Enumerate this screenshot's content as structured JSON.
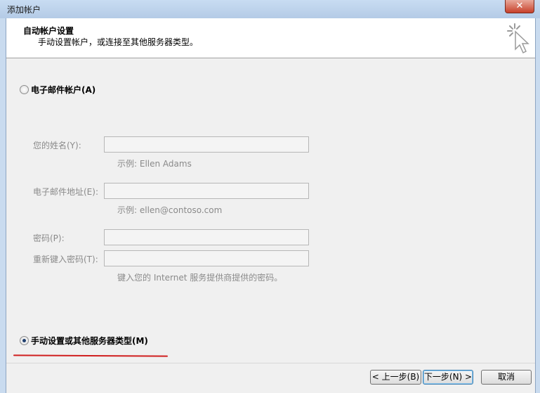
{
  "window": {
    "title": "添加帐户",
    "close_glyph": "✕"
  },
  "header": {
    "title": "自动帐户设置",
    "subtitle": "手动设置帐户，或连接至其他服务器类型。",
    "icon": "wizard-sparkle-cursor-icon"
  },
  "email_option": {
    "label": "电子邮件帐户(A)",
    "selected": false
  },
  "form": {
    "name_label": "您的姓名(Y):",
    "name_hint": "示例: Ellen Adams",
    "email_label": "电子邮件地址(E):",
    "email_hint": "示例: ellen@contoso.com",
    "password_label": "密码(P):",
    "retype_label": "重新键入密码(T):",
    "password_hint": "键入您的 Internet 服务提供商提供的密码。"
  },
  "manual_option": {
    "label": "手动设置或其他服务器类型(M)",
    "selected": true
  },
  "buttons": {
    "back": "< 上一步(B)",
    "next": "下一步(N) >",
    "cancel": "取消"
  },
  "colors": {
    "annotation_underline": "#d01f1f"
  }
}
